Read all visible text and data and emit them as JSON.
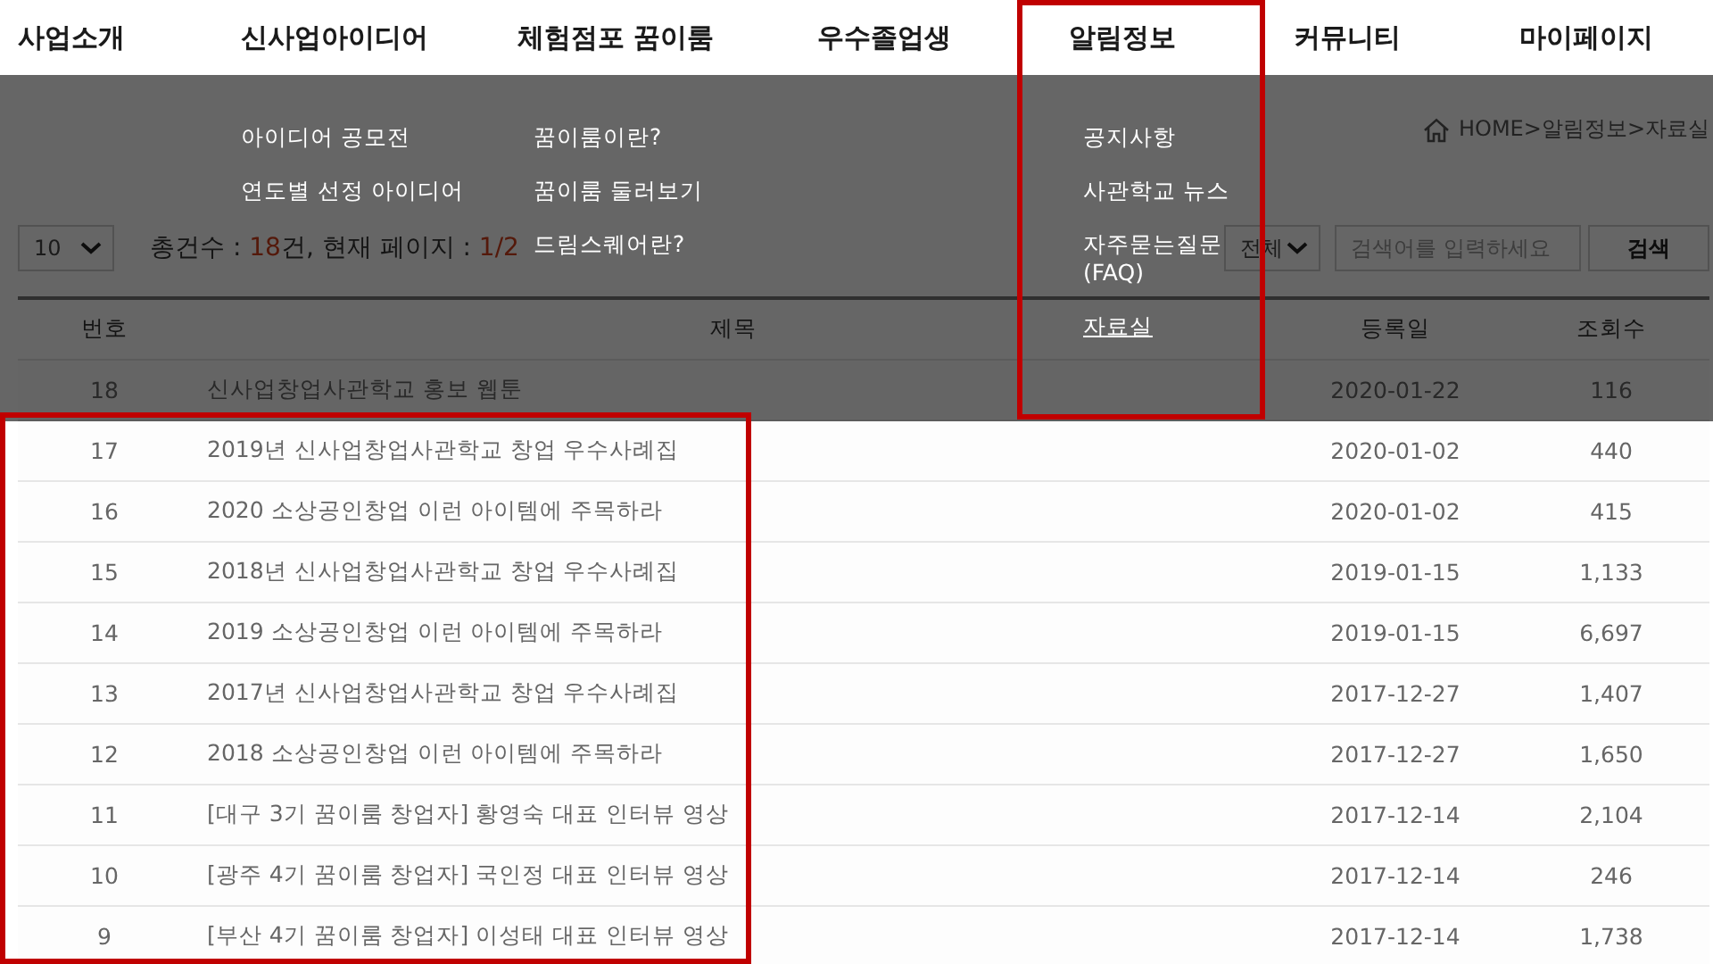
{
  "nav": [
    {
      "label": "사업소개"
    },
    {
      "label": "신사업아이디어",
      "submenu": [
        {
          "label": "아이디어 공모전",
          "current": false
        },
        {
          "label": "연도별 선정 아이디어",
          "current": false
        }
      ]
    },
    {
      "label": "체험점포 꿈이룸",
      "submenu": [
        {
          "label": "꿈이룸이란?",
          "current": false
        },
        {
          "label": "꿈이룸 둘러보기",
          "current": false
        },
        {
          "label": "드림스퀘어란?",
          "current": false
        }
      ]
    },
    {
      "label": "우수졸업생"
    },
    {
      "label": "알림정보",
      "submenu": [
        {
          "label": "공지사항",
          "current": false
        },
        {
          "label": "사관학교 뉴스",
          "current": false
        },
        {
          "label": "자주묻는질문 (FAQ)",
          "current": false
        },
        {
          "label": "자료실",
          "current": true
        }
      ]
    },
    {
      "label": "커뮤니티"
    },
    {
      "label": "마이페이지"
    }
  ],
  "breadcrumb": "HOME>알림정보>자료실",
  "toolbar": {
    "page_size": "10",
    "summary": {
      "total_label": "총건수 : ",
      "total": "18",
      "middle": "건, 현재 페이지 : ",
      "page": "1/2"
    },
    "scope": "전체",
    "search": {
      "placeholder": "검색어를 입력하세요"
    },
    "search_button": "검색"
  },
  "table": {
    "columns": [
      "번호",
      "제목",
      "등록일",
      "조회수"
    ],
    "rows": [
      {
        "no": "18",
        "title": "신사업창업사관학교 홍보 웹툰",
        "date": "2020-01-22",
        "views": "116"
      },
      {
        "no": "17",
        "title": "2019년 신사업창업사관학교 창업 우수사례집",
        "date": "2020-01-02",
        "views": "440"
      },
      {
        "no": "16",
        "title": "2020 소상공인창업 이런 아이템에 주목하라",
        "date": "2020-01-02",
        "views": "415"
      },
      {
        "no": "15",
        "title": "2018년 신사업창업사관학교 창업 우수사례집",
        "date": "2019-01-15",
        "views": "1,133"
      },
      {
        "no": "14",
        "title": "2019 소상공인창업 이런 아이템에 주목하라",
        "date": "2019-01-15",
        "views": "6,697"
      },
      {
        "no": "13",
        "title": "2017년 신사업창업사관학교 창업 우수사례집",
        "date": "2017-12-27",
        "views": "1,407"
      },
      {
        "no": "12",
        "title": "2018 소상공인창업 이런 아이템에 주목하라",
        "date": "2017-12-27",
        "views": "1,650"
      },
      {
        "no": "11",
        "title": "[대구 3기 꿈이룸 창업자] 황영숙 대표 인터뷰 영상",
        "date": "2017-12-14",
        "views": "2,104"
      },
      {
        "no": "10",
        "title": "[광주 4기 꿈이룸 창업자] 국인정 대표 인터뷰 영상",
        "date": "2017-12-14",
        "views": "246"
      },
      {
        "no": "9",
        "title": "[부산 4기 꿈이룸 창업자] 이성태 대표 인터뷰 영상",
        "date": "2017-12-14",
        "views": "1,738"
      }
    ]
  },
  "highlights": {
    "menu_column": true,
    "list_rows": true
  }
}
